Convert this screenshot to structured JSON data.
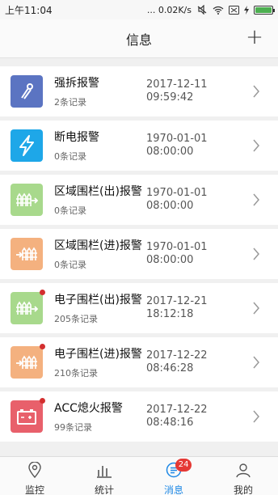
{
  "status_bar": {
    "time": "上午11:04",
    "network_speed": "...  0.02K/s",
    "battery_color": "#4caf50"
  },
  "header": {
    "title": "信息",
    "add_label": "+"
  },
  "alerts": [
    {
      "name": "强拆报警",
      "count": "2条记录",
      "date": "2017-12-11",
      "clock": "09:59:42",
      "icon": "pliers-icon",
      "color": "#5b74c2",
      "dot": false
    },
    {
      "name": "断电报警",
      "count": "0条记录",
      "date": "1970-01-01",
      "clock": "08:00:00",
      "icon": "lightning-icon",
      "color": "#1ea7e8",
      "dot": false
    },
    {
      "name": "区域围栏(出)报警",
      "count": "0条记录",
      "date": "1970-01-01",
      "clock": "08:00:00",
      "icon": "fence-out-icon",
      "color": "#a8d98c",
      "dot": false
    },
    {
      "name": "区域围栏(进)报警",
      "count": "0条记录",
      "date": "1970-01-01",
      "clock": "08:00:00",
      "icon": "fence-in-icon",
      "color": "#f4b17f",
      "dot": false
    },
    {
      "name": "电子围栏(出)报警",
      "count": "205条记录",
      "date": "2017-12-21",
      "clock": "18:12:18",
      "icon": "fence-out-icon",
      "color": "#a8d98c",
      "dot": true
    },
    {
      "name": "电子围栏(进)报警",
      "count": "210条记录",
      "date": "2017-12-22",
      "clock": "08:46:28",
      "icon": "fence-in-icon",
      "color": "#f4b17f",
      "dot": true
    },
    {
      "name": "ACC熄火报警",
      "count": "99条记录",
      "date": "2017-12-22",
      "clock": "08:48:16",
      "icon": "battery-icon",
      "color": "#e8606b",
      "dot": true
    }
  ],
  "tabs": [
    {
      "label": "监控",
      "icon": "location-pin-icon",
      "active": false
    },
    {
      "label": "统计",
      "icon": "bar-chart-icon",
      "active": false
    },
    {
      "label": "消息",
      "icon": "message-icon",
      "active": true,
      "badge": "24"
    },
    {
      "label": "我的",
      "icon": "user-icon",
      "active": false
    }
  ],
  "accent_color": "#1e88e5"
}
